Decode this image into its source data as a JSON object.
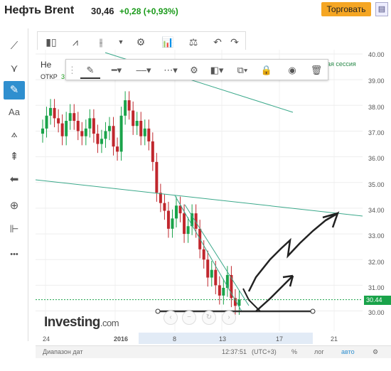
{
  "header": {
    "title": "Нефть Brent",
    "price": "30,46",
    "change": "+0,28 (+0,93%)",
    "trade_label": "Торговать",
    "add_icon": "add-to-portfolio-icon"
  },
  "left_toolbar": {
    "items": [
      "line-tool-icon",
      "fork-tool-icon",
      "brush-tool-icon",
      "text-tool-icon",
      "pattern-tool-icon",
      "fib-tool-icon",
      "arrow-left-icon",
      "zoom-icon",
      "ruler-icon",
      "more-icon"
    ],
    "text_tool_label": "Aa",
    "more_label": "•••"
  },
  "top_toolbar": {
    "items": [
      "candles-icon",
      "area-icon",
      "bars-icon",
      "dropdown-icon",
      "settings-icon",
      "indicators-icon",
      "compare-icon",
      "undo-icon",
      "redo-icon"
    ]
  },
  "draw_toolbar": {
    "items": [
      "pencil-icon",
      "line-width-icon",
      "line-style-dashed-icon",
      "line-style-dotted-icon",
      "settings-icon",
      "fill-icon",
      "layer-icon",
      "lock-icon",
      "visibility-icon",
      "delete-icon"
    ]
  },
  "legend": {
    "name": "Не",
    "open_label": "ОТКР",
    "open_value": "3",
    "session": "ая сессия"
  },
  "y_axis": [
    "40.00",
    "39.00",
    "38.00",
    "37.00",
    "36.00",
    "35.00",
    "34.00",
    "33.00",
    "32.00",
    "31.00",
    "30.00"
  ],
  "current_price_tag": "30.44",
  "x_axis": [
    "24",
    "2016",
    "8",
    "13",
    "17",
    "21"
  ],
  "watermark": {
    "brand": "Investing",
    "tld": ".com"
  },
  "bottom_bar": {
    "range_label": "Диапазон дат",
    "time": "12:37:51",
    "tz": "(UTC+3)",
    "pct": "%",
    "log": "лог",
    "auto": "авто"
  },
  "colors": {
    "up": "#1aa34a",
    "down": "#c0272d",
    "trend": "#3aa88a",
    "accent": "#2f8fcf",
    "trade": "#f5a623"
  },
  "chart_data": {
    "type": "candlestick",
    "y_range": [
      29.6,
      40.0
    ],
    "x_ticks": [
      "24",
      "2016",
      "8",
      "13",
      "17",
      "21"
    ],
    "closes": [
      37.1,
      37.6,
      37.9,
      37.5,
      37.3,
      36.8,
      37.4,
      37.7,
      37.4,
      37.0,
      36.8,
      37.1,
      37.5,
      36.9,
      36.5,
      36.7,
      37.0,
      37.2,
      36.4,
      36.2,
      37.6,
      38.2,
      37.8,
      37.2,
      37.4,
      36.8,
      37.1,
      36.6,
      35.8,
      34.6,
      34.2,
      33.9,
      33.2,
      33.6,
      34.1,
      33.8,
      33.0,
      33.3,
      33.8,
      33.2,
      32.4,
      32.0,
      31.3,
      31.6,
      31.0,
      30.6,
      30.9,
      31.4,
      30.5,
      30.2,
      30.44
    ]
  }
}
